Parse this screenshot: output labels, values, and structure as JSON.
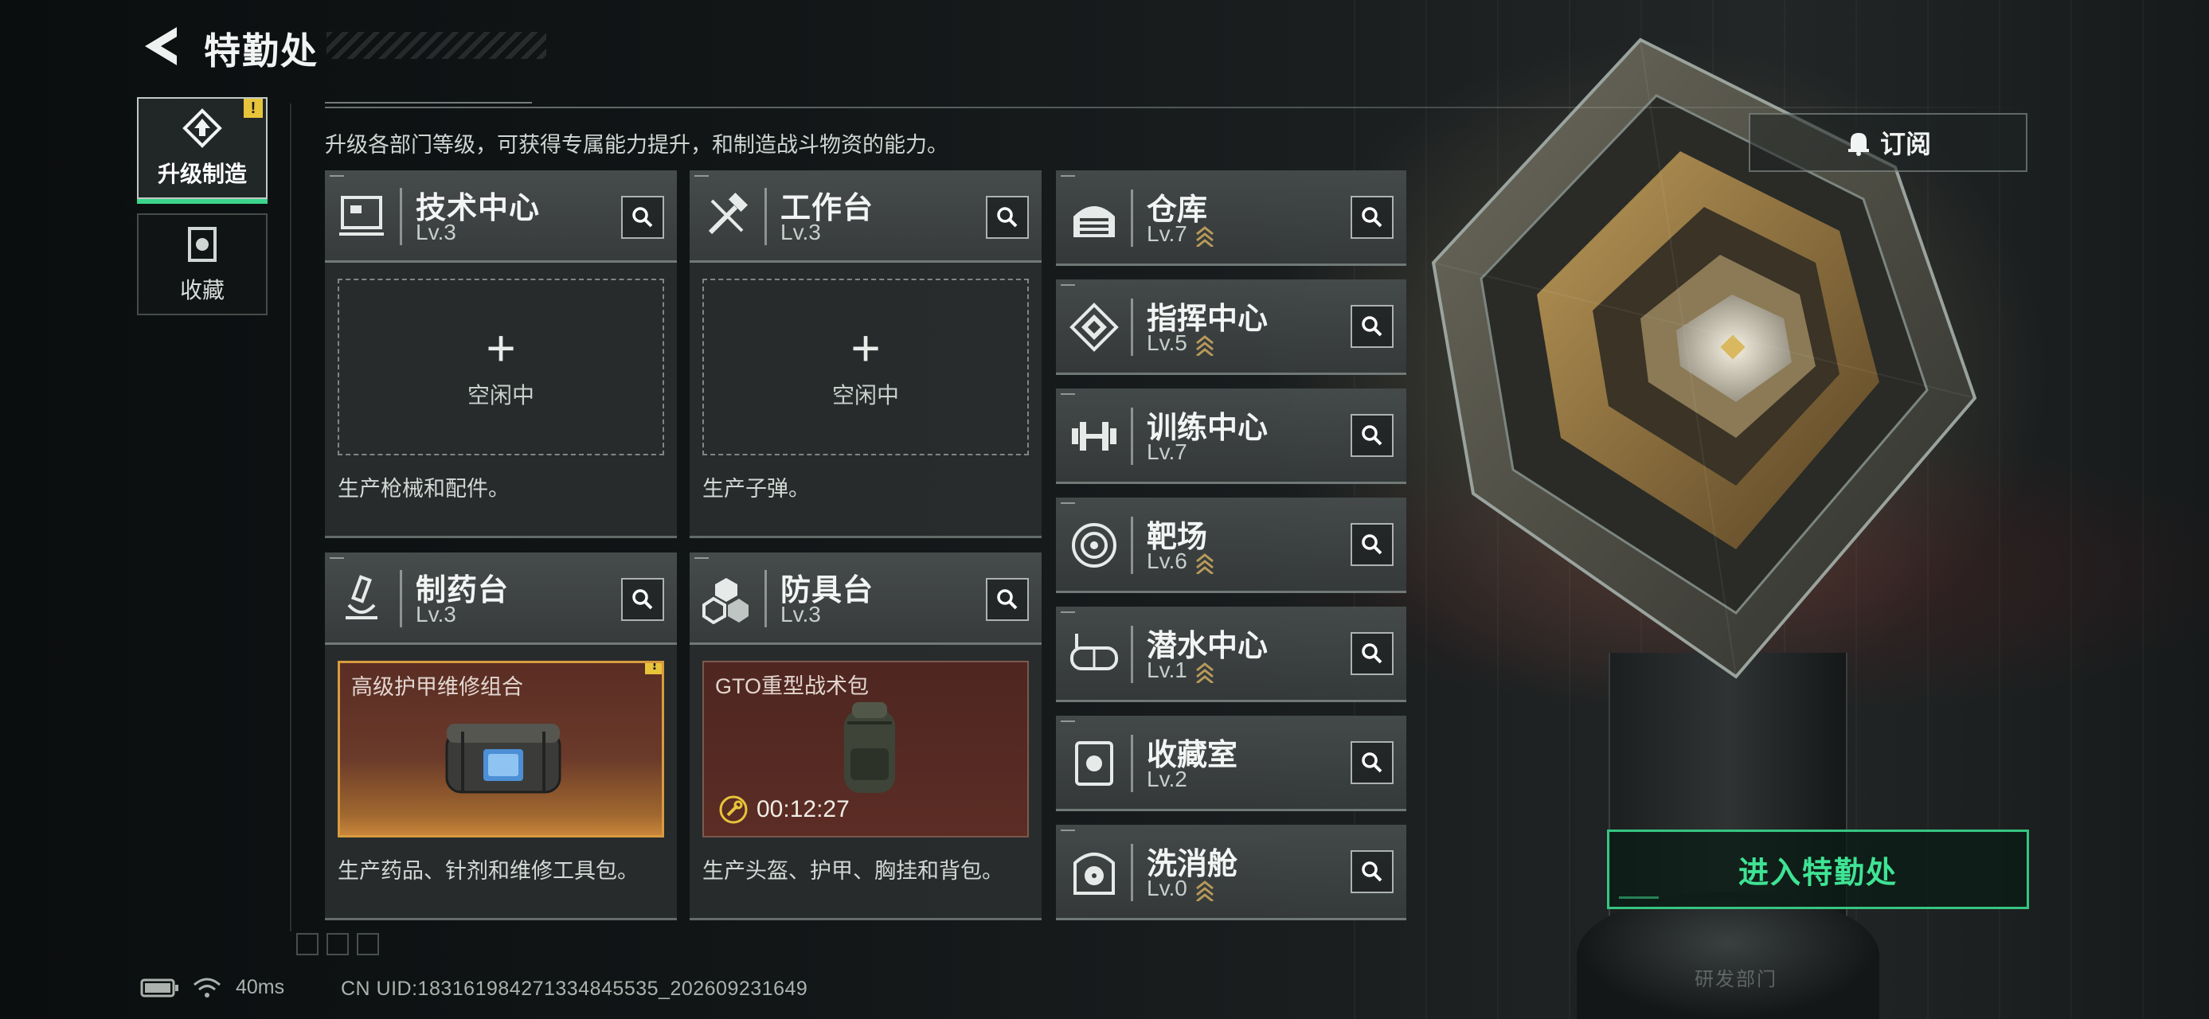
{
  "header": {
    "title": "特勤处",
    "subtitle": "升级各部门等级，可获得专属能力提升，和制造战斗物资的能力。"
  },
  "nav": {
    "tabs": [
      {
        "label": "升级制造",
        "active": true,
        "alert": "!"
      },
      {
        "label": "收藏",
        "active": false
      }
    ]
  },
  "workshops": [
    {
      "name": "技术中心",
      "level": "Lv.3",
      "slot": {
        "state": "idle",
        "label": "空闲中",
        "plus": "+"
      },
      "desc": "生产枪械和配件。"
    },
    {
      "name": "工作台",
      "level": "Lv.3",
      "slot": {
        "state": "idle",
        "label": "空闲中",
        "plus": "+"
      },
      "desc": "生产子弹。"
    },
    {
      "name": "制药台",
      "level": "Lv.3",
      "slot": {
        "state": "done",
        "item": "高级护甲维修组合",
        "alert": "!"
      },
      "desc": "生产药品、针剂和维修工具包。"
    },
    {
      "name": "防具台",
      "level": "Lv.3",
      "slot": {
        "state": "working",
        "item": "GTO重型战术包",
        "timer": "00:12:27"
      },
      "desc": "生产头盔、护甲、胸挂和背包。"
    }
  ],
  "facilities": [
    {
      "name": "仓库",
      "level": "Lv.7",
      "upgradable": true,
      "icon": "warehouse-icon"
    },
    {
      "name": "指挥中心",
      "level": "Lv.5",
      "upgradable": true,
      "icon": "command-center-icon"
    },
    {
      "name": "训练中心",
      "level": "Lv.7",
      "upgradable": false,
      "icon": "dumbbell-icon"
    },
    {
      "name": "靶场",
      "level": "Lv.6",
      "upgradable": true,
      "icon": "target-icon"
    },
    {
      "name": "潜水中心",
      "level": "Lv.1",
      "upgradable": true,
      "icon": "diving-mask-icon"
    },
    {
      "name": "收藏室",
      "level": "Lv.2",
      "upgradable": false,
      "icon": "collection-icon"
    },
    {
      "name": "洗消舱",
      "level": "Lv.0",
      "upgradable": true,
      "icon": "radiation-icon"
    }
  ],
  "actions": {
    "subscribe": "订阅",
    "enter": "进入特勤处"
  },
  "status": {
    "ping": "40ms",
    "uid": "CN UID:18316198427133484553​5_202609231649"
  },
  "scene": {
    "pillar_label": "研发部门"
  },
  "colors": {
    "accent_green": "#3fe394",
    "alert_yellow": "#e8c43a",
    "upgrade_gold": "#b89a5a",
    "done_border": "#d99b3f"
  }
}
